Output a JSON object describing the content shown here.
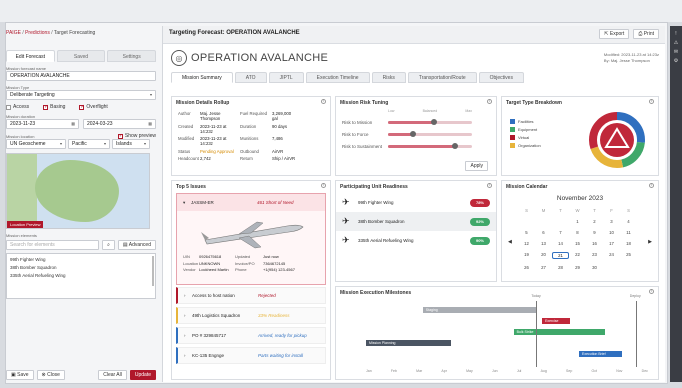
{
  "breadcrumb": {
    "root": "PAIGE",
    "sep": "/",
    "section": "Predictions",
    "current": "Target Forecasting"
  },
  "left": {
    "tabs": [
      "Edit Forecast",
      "Saved",
      "Settings"
    ],
    "name_label": "Mission forecast name",
    "name_value": "OPERATION AVALANCHE",
    "type_label": "Mission Type",
    "type_value": "Deliberate Targeting",
    "checks": [
      {
        "label": "Access",
        "on": false
      },
      {
        "label": "Basing",
        "on": true
      },
      {
        "label": "Overflight",
        "on": true
      }
    ],
    "duration_label": "Mission duration",
    "start_date": "2023-11-23",
    "end_date": "2024-03-23",
    "location_label": "Mission location",
    "show_preview": "Show preview",
    "loc_values": [
      "UN Geoscheme",
      "Pacific",
      "Islands"
    ],
    "map_tag": "Location Preview",
    "elements_label": "Mission elements",
    "search_placeholder": "Search for elements",
    "advanced": "Advanced",
    "elements": [
      "99th Fighter Wing",
      "38th Bomber Squadron",
      "335th Aerial Refueling Wing"
    ],
    "footer": {
      "save": "Save",
      "close": "Close",
      "clear": "Clear All",
      "update": "Update"
    }
  },
  "main": {
    "header_title": "Targeting Forecast: OPERATION AVALANCHE",
    "export": "Export",
    "print": "Print",
    "op_name": "OPERATION AVALANCHE",
    "meta": {
      "modified_label": "Modified:",
      "modified_value": "2023-11-23 at 14:23z",
      "by_label": "By:",
      "by_value": "Maj. Jesse Thompson"
    },
    "tabs": [
      "Mission Summary",
      "ATO",
      "JIPTL",
      "Execution Timeline",
      "Risks",
      "Transportation/Route",
      "Objectives"
    ],
    "details": {
      "title": "Mission Details Rollup",
      "rows": [
        [
          "Author",
          "Maj. Jesse Thompson",
          "Fuel Required",
          "3,269,000 gal"
        ],
        [
          "Created",
          "2023-11-23 at 14:23z",
          "Duration",
          "90 days"
        ],
        [
          "Modified",
          "2023-11-23 at 14:23z",
          "Munitions",
          "7,486"
        ],
        [
          "Status",
          "Pending Approval",
          "Outbound",
          "AirVR"
        ],
        [
          "Headcount",
          "2,742",
          "Return",
          "Ship / AirVR"
        ]
      ]
    },
    "risk": {
      "title": "Mission Risk Tuning",
      "scale": [
        "Low",
        "Balanced",
        "Max"
      ],
      "rows": [
        {
          "label": "Risk to Mission",
          "value": 0.55
        },
        {
          "label": "Risk to Force",
          "value": 0.3
        },
        {
          "label": "Risk to Sustainment",
          "value": 0.8
        }
      ],
      "apply": "Apply"
    },
    "breakdown": {
      "title": "Target Type Breakdown",
      "legend": [
        {
          "label": "Facilities",
          "color": "#2f6fbf"
        },
        {
          "label": "Equipment",
          "color": "#3fa86a"
        },
        {
          "label": "Virtual",
          "color": "#b0182b"
        },
        {
          "label": "Organization",
          "color": "#e7b43a"
        }
      ]
    },
    "issues": {
      "title": "Top 5 Issues",
      "first": {
        "name": "JASSM-ER",
        "status": "461 Short of Need"
      },
      "specs": [
        [
          "UIN",
          "0926475618",
          "Updated",
          "Just now"
        ],
        [
          "Location",
          "UNKNOWN",
          "Invoice/PO",
          "7364672145"
        ],
        [
          "Vendor",
          "Lockheed Martin",
          "Phone",
          "+1(954) 123-4567"
        ]
      ],
      "rows": [
        {
          "name": "Access to host nation",
          "status": "Rejected",
          "color": "#b0182b"
        },
        {
          "name": "49th Logistics Squadron",
          "status": "33% Readiness",
          "color": "#e7b43a"
        },
        {
          "name": "PO # 329845717",
          "status": "Arrived, ready for pickup",
          "color": "#2f6fbf"
        },
        {
          "name": "KC-135 Engnge",
          "status": "Parts waiting for install",
          "color": "#2f6fbf"
        }
      ]
    },
    "readiness": {
      "title": "Participating Unit Readiness",
      "units": [
        {
          "name": "99th Fighter Wing",
          "value": "78%",
          "color": "#c0283a",
          "icon": "✈"
        },
        {
          "name": "38th Bomber Squadron",
          "value": "92%",
          "color": "#3fa86a",
          "icon": "✈"
        },
        {
          "name": "335th Aerial Refueling Wing",
          "value": "90%",
          "color": "#3fa86a",
          "icon": "✈"
        }
      ]
    },
    "calendar": {
      "title": "Mission Calendar",
      "month": "November 2023",
      "days_header": [
        "S",
        "M",
        "T",
        "W",
        "T",
        "F",
        "S"
      ],
      "weeks": [
        [
          "",
          "",
          "",
          "1",
          "2",
          "3",
          "4"
        ],
        [
          "5",
          "6",
          "7",
          "8",
          "9",
          "10",
          "11"
        ],
        [
          "12",
          "13",
          "14",
          "15",
          "16",
          "17",
          "18"
        ],
        [
          "19",
          "20",
          "21",
          "22",
          "23",
          "24",
          "25"
        ],
        [
          "26",
          "27",
          "28",
          "29",
          "30",
          "",
          ""
        ]
      ]
    },
    "milestones": {
      "title": "Mission Execution Milestones",
      "today": "Today",
      "deploy": "Deploy",
      "bars": [
        {
          "label": "Staging",
          "color": "#a9adb3",
          "start": 0.2,
          "end": 0.6
        },
        {
          "label": "Exercise",
          "color": "#c0283a",
          "start": 0.62,
          "end": 0.72
        },
        {
          "label": "Bulk Strike",
          "color": "#3fa86a",
          "start": 0.52,
          "end": 0.84
        },
        {
          "label": "Mission Planning",
          "color": "#4b5563",
          "start": 0.0,
          "end": 0.3
        },
        {
          "label": "Execution Brief",
          "color": "#2f6fbf",
          "start": 0.75,
          "end": 0.9
        }
      ],
      "axis": [
        "Jan",
        "Feb",
        "Mar",
        "Apr",
        "May",
        "Jun",
        "Jul",
        "Aug",
        "Sep",
        "Oct",
        "Nov",
        "Dec"
      ]
    }
  }
}
